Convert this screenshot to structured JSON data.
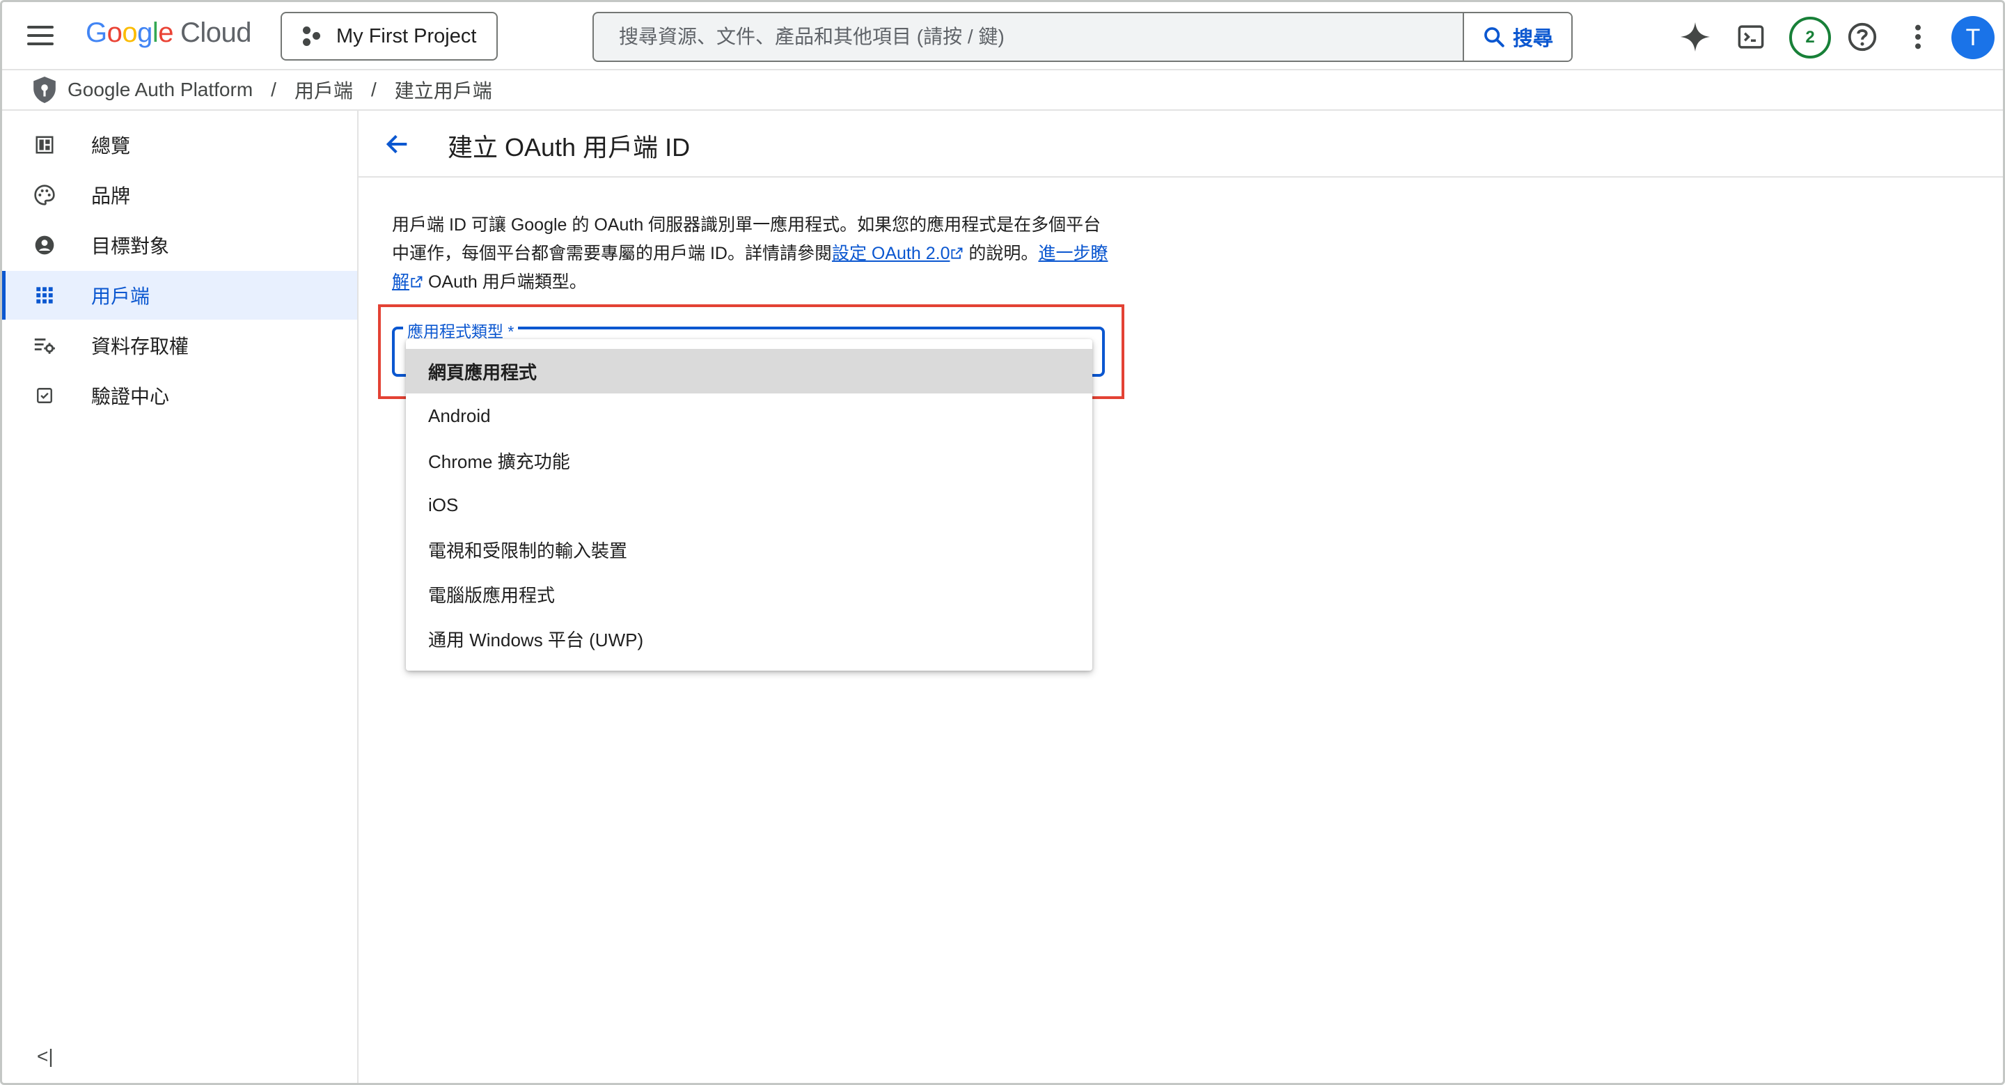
{
  "header": {
    "logo_google": [
      "G",
      "o",
      "o",
      "g",
      "l",
      "e"
    ],
    "logo_cloud": "Cloud",
    "project_name": "My First Project",
    "search_placeholder": "搜尋資源、文件、產品和其他項目 (請按 / 鍵)",
    "search_button": "搜尋",
    "notification_count": "2",
    "avatar_letter": "T"
  },
  "breadcrumb": {
    "items": [
      "Google Auth Platform",
      "用戶端",
      "建立用戶端"
    ],
    "separator": "/"
  },
  "sidebar": {
    "items": [
      {
        "label": "總覽",
        "icon": "dashboard-icon"
      },
      {
        "label": "品牌",
        "icon": "palette-icon"
      },
      {
        "label": "目標對象",
        "icon": "account-circle-icon"
      },
      {
        "label": "用戶端",
        "icon": "apps-grid-icon",
        "active": true
      },
      {
        "label": "資料存取權",
        "icon": "data-access-icon"
      },
      {
        "label": "驗證中心",
        "icon": "verified-checkbox-icon"
      }
    ],
    "collapse_label": "<|"
  },
  "page": {
    "title": "建立 OAuth 用戶端 ID",
    "desc_part1": "用戶端 ID 可讓 Google 的 OAuth 伺服器識別單一應用程式。如果您的應用程式是在多個平台中運作，每個平台都會需要專屬的用戶端 ID。詳情請參閱",
    "desc_link1": "設定 OAuth 2.0",
    "desc_part2": " 的說明。",
    "desc_link2": "進一步瞭解",
    "desc_part3": " OAuth 用戶端類型。",
    "select_label": "應用程式類型 *"
  },
  "dropdown": {
    "options": [
      "網頁應用程式",
      "Android",
      "Chrome 擴充功能",
      "iOS",
      "電視和受限制的輸入裝置",
      "電腦版應用程式",
      "通用 Windows 平台 (UWP)"
    ],
    "selected": "網頁應用程式"
  },
  "colors": {
    "accent": "#0b57d0",
    "highlight_border": "#e34234",
    "active_bg": "#e8f0fe",
    "badge_green": "#188038"
  }
}
